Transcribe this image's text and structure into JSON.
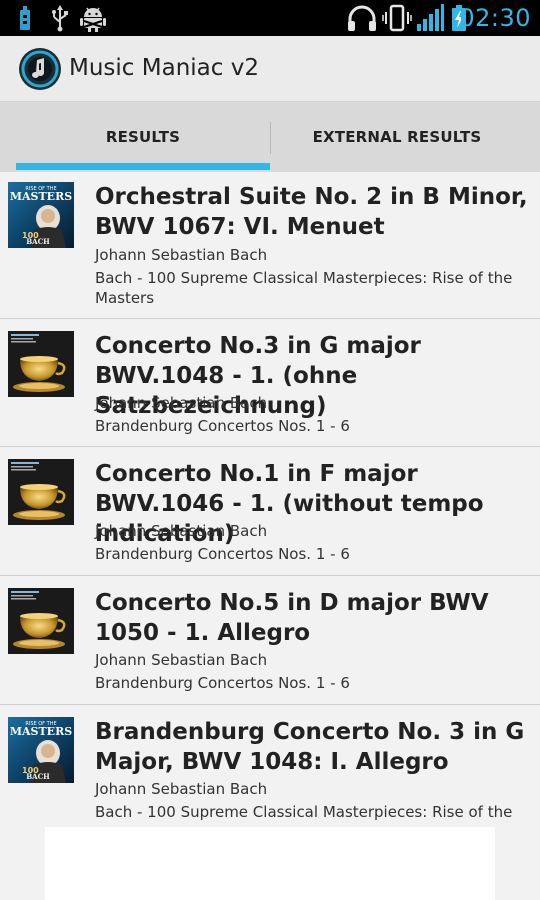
{
  "status_bar": {
    "time": "02:30",
    "left_icons": [
      "usb-icon",
      "usb-debug-icon",
      "android-debug-icon"
    ],
    "right_icons": [
      "headphones-icon",
      "vibrate-icon",
      "signal-icon",
      "battery-charging-icon"
    ],
    "accent_color": "#33b5e5"
  },
  "app_bar": {
    "title": "Music Maniac v2",
    "logo_icon": "music-note-logo-icon"
  },
  "tabs": [
    {
      "label": "RESULTS",
      "selected": true
    },
    {
      "label": "EXTERNAL RESULTS",
      "selected": false
    }
  ],
  "tracks": [
    {
      "title": "Orchestral Suite No. 2 in B Minor, BWV 1067: VI. Menuet",
      "artist": "Johann Sebastian Bach",
      "album": "Bach - 100 Supreme Classical Masterpieces: Rise of the Masters",
      "cover": "masters-bach-cover"
    },
    {
      "title": "Concerto No.3 in G major BWV.1048 - 1. (ohne Satzbezeichnung)",
      "artist": "Johann Sebastian Bach",
      "album": "Brandenburg Concertos Nos. 1 - 6",
      "cover": "golden-cup-cover"
    },
    {
      "title": "Concerto No.1 in F major BWV.1046 - 1. (without tempo indication)",
      "artist": "Johann Sebastian Bach",
      "album": "Brandenburg Concertos Nos. 1 - 6",
      "cover": "golden-cup-cover"
    },
    {
      "title": "Concerto No.5 in D major BWV 1050 - 1. Allegro",
      "artist": "Johann Sebastian Bach",
      "album": "Brandenburg Concertos Nos. 1 - 6",
      "cover": "golden-cup-cover"
    },
    {
      "title": "Brandenburg Concerto No. 3 in G Major, BWV 1048: I. Allegro",
      "artist": "Johann Sebastian Bach",
      "album": "Bach - 100 Supreme Classical Masterpieces: Rise of the",
      "cover": "masters-bach-cover"
    }
  ],
  "cover_text": {
    "masters_top": "RISE OF THE",
    "masters_word": "MASTERS",
    "masters_count": "100",
    "masters_name": "BACH"
  }
}
